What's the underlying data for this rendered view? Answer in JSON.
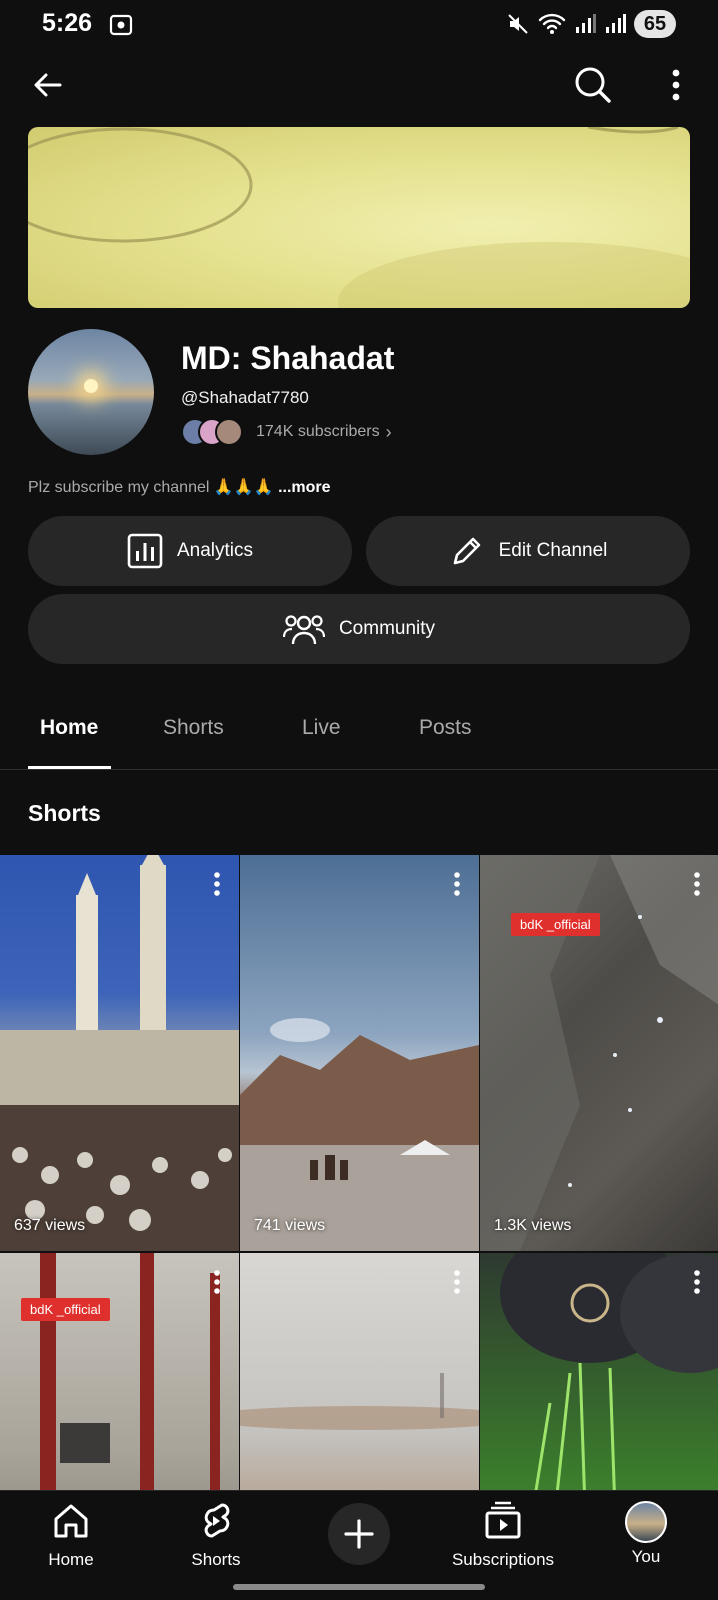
{
  "status_bar": {
    "time": "5:26",
    "battery": "65"
  },
  "channel": {
    "name": "MD: Shahadat",
    "handle": "@Shahadat7780",
    "subscribers": "174K subscribers",
    "description": "Plz subscribe my channel 🙏🙏🙏",
    "more_label": "...more"
  },
  "actions": {
    "analytics": "Analytics",
    "edit_channel": "Edit Channel",
    "community": "Community"
  },
  "tabs": [
    {
      "label": "Home",
      "active": true
    },
    {
      "label": "Shorts",
      "active": false
    },
    {
      "label": "Live",
      "active": false
    },
    {
      "label": "Posts",
      "active": false
    }
  ],
  "section": {
    "title": "Shorts"
  },
  "shorts": [
    {
      "views": "637 views"
    },
    {
      "views": "741 views"
    },
    {
      "views": "1.3K views",
      "badge": "bdK _official"
    },
    {
      "views": "",
      "badge": "bdK _official"
    },
    {
      "views": ""
    },
    {
      "views": ""
    }
  ],
  "bottom_nav": {
    "home": "Home",
    "shorts": "Shorts",
    "subscriptions": "Subscriptions",
    "you": "You"
  }
}
